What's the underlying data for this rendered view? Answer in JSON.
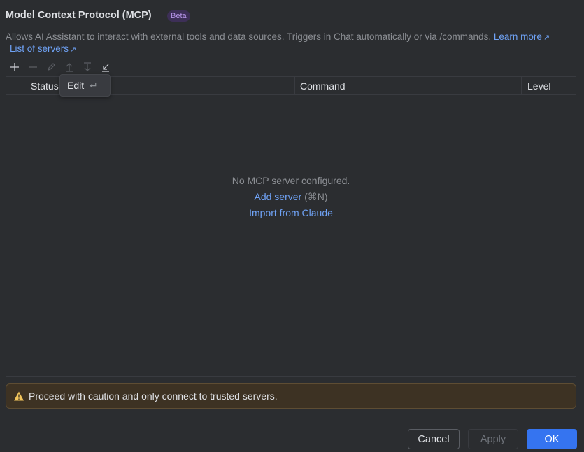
{
  "header": {
    "title": "Model Context Protocol (MCP)",
    "badge": "Beta",
    "description": "Allows AI Assistant to interact with external tools and data sources. Triggers in Chat automatically or via /commands.",
    "learn_more": "Learn more",
    "list_of_servers": "List of servers",
    "external_arrow": "↗"
  },
  "toolbar": {
    "icons": [
      "add-icon",
      "remove-icon",
      "edit-icon",
      "move-up-icon",
      "move-down-icon",
      "import-icon"
    ]
  },
  "tooltip": {
    "label": "Edit",
    "shortcut": "↵"
  },
  "table": {
    "columns": [
      "Status",
      "Command",
      "Level"
    ],
    "empty_message": "No MCP server configured.",
    "add_server": "Add server",
    "add_server_shortcut": "(⌘N)",
    "import": "Import from Claude"
  },
  "warning": {
    "text": "Proceed with caution and only connect to trusted servers."
  },
  "footer": {
    "cancel": "Cancel",
    "apply": "Apply",
    "ok": "OK"
  },
  "colors": {
    "accent": "#3574f0",
    "link": "#6fa2f5",
    "badge_bg": "#3d2f57",
    "warning_bg": "#3d3223"
  }
}
